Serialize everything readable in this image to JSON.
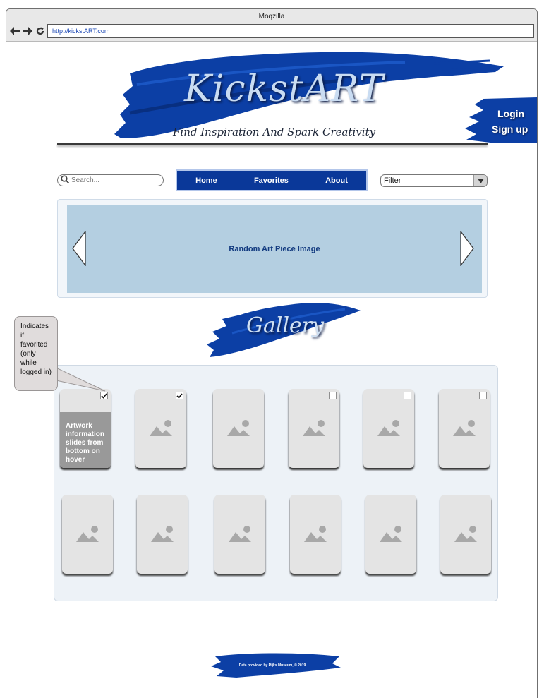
{
  "browser": {
    "title": "Moqzilla",
    "url": "http://kickstART.com"
  },
  "header": {
    "logo": "KickstART",
    "tagline": "Find Inspiration And Spark Creativity",
    "login_label": "Login",
    "signup_label": "Sign up"
  },
  "toolbar": {
    "search_placeholder": "Search...",
    "nav": [
      "Home",
      "Favorites",
      "About"
    ],
    "filter_value": "Filter"
  },
  "carousel": {
    "label": "Random Art Piece Image"
  },
  "gallery": {
    "title": "Gallery",
    "callout": "Indicates if favorited (only while logged in)",
    "hover_info": "Artwork information slides from bottom on hover",
    "favorites_row1": [
      true,
      true,
      false,
      false,
      false,
      false
    ]
  },
  "footer": {
    "credit": "Data provided by Rijks Museum, © 2019"
  },
  "colors": {
    "brand_blue": "#0a3899",
    "panel": "#edf2f7",
    "carousel_bg": "#b4cfe1"
  }
}
